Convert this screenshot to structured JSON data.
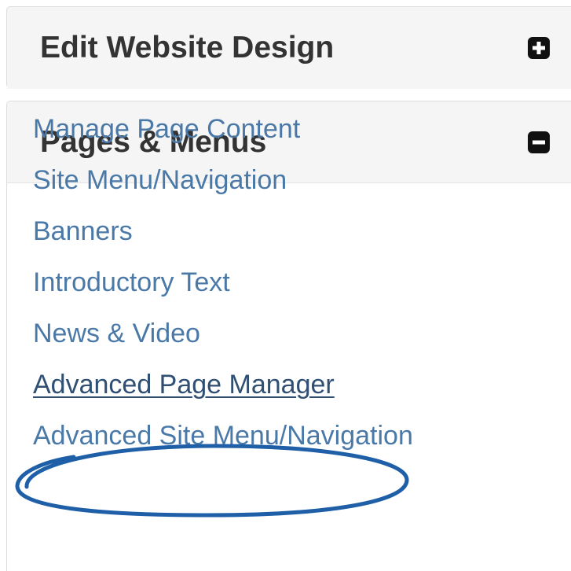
{
  "panels": [
    {
      "title": "Edit Website Design",
      "toggle_icon": "plus-square-icon",
      "expanded": false
    },
    {
      "title": "Pages & Menus",
      "toggle_icon": "minus-square-icon",
      "expanded": true,
      "links": [
        {
          "label": "Manage Page Content"
        },
        {
          "label": "Site Menu/Navigation"
        },
        {
          "label": "Banners"
        },
        {
          "label": "Introductory Text"
        },
        {
          "label": "News & Video"
        },
        {
          "label": "Advanced Page Manager",
          "highlighted": true
        },
        {
          "label": "Advanced Site Menu/Navigation"
        }
      ]
    }
  ],
  "colors": {
    "link": "#4a79a8",
    "link_hover": "#2f4f73",
    "heading_bg": "#f5f5f5",
    "heading_text": "#333333",
    "highlight_ring": "#1f5fa8"
  }
}
